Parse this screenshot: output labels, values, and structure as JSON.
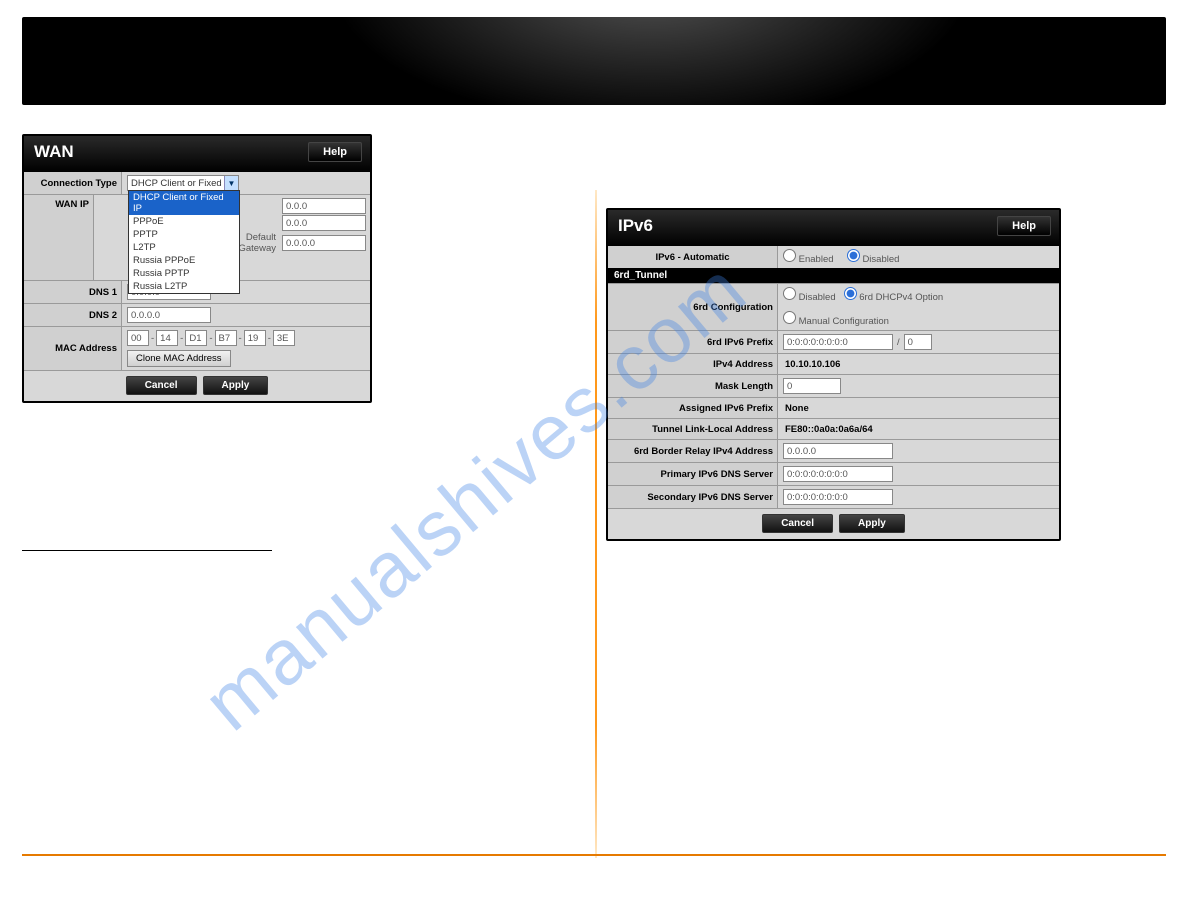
{
  "watermark": "manualshives.com",
  "wan": {
    "title": "WAN",
    "help": "Help",
    "rows": {
      "connection_type": "Connection Type",
      "wan_ip": "WAN IP",
      "default_gateway_label": "Default Gateway",
      "dns1": "DNS 1",
      "dns2": "DNS 2",
      "mac_address": "MAC Address"
    },
    "connection_selected": "DHCP Client or Fixed IP",
    "connection_options": [
      "DHCP Client or Fixed IP",
      "PPPoE",
      "PPTP",
      "L2TP",
      "Russia PPPoE",
      "Russia PPTP",
      "Russia L2TP"
    ],
    "wan_ip_lines": [
      {
        "value": "0.0.0"
      },
      {
        "value": "0.0.0"
      },
      {
        "value": "0.0.0.0"
      }
    ],
    "dns1_value": "0.0.0.0",
    "dns2_value": "0.0.0.0",
    "mac": [
      "00",
      "14",
      "D1",
      "B7",
      "19",
      "3E"
    ],
    "clone_mac": "Clone MAC Address",
    "cancel": "Cancel",
    "apply": "Apply"
  },
  "ipv6": {
    "title": "IPv6",
    "help": "Help",
    "auto_label": "IPv6 - Automatic",
    "auto_enabled": "Enabled",
    "auto_disabled": "Disabled",
    "auto_selected": "disabled",
    "section": "6rd_Tunnel",
    "rows": {
      "cfg": "6rd Configuration",
      "cfg_opts": {
        "disabled": "Disabled",
        "dhcp": "6rd DHCPv4 Option",
        "manual": "Manual Configuration"
      },
      "cfg_selected": "dhcp",
      "prefix": "6rd IPv6 Prefix",
      "prefix_val": "0:0:0:0:0:0:0:0",
      "prefix_len": "0",
      "ipv4": "IPv4 Address",
      "ipv4_val": "10.10.10.106",
      "mask": "Mask Length",
      "mask_val": "0",
      "assigned": "Assigned IPv6 Prefix",
      "assigned_val": "None",
      "tll": "Tunnel Link-Local Address",
      "tll_val": "FE80::0a0a:0a6a/64",
      "relay": "6rd Border Relay IPv4 Address",
      "relay_val": "0.0.0.0",
      "pdns": "Primary IPv6 DNS Server",
      "pdns_val": "0:0:0:0:0:0:0:0",
      "sdns": "Secondary IPv6 DNS Server",
      "sdns_val": "0:0:0:0:0:0:0:0"
    },
    "cancel": "Cancel",
    "apply": "Apply"
  }
}
